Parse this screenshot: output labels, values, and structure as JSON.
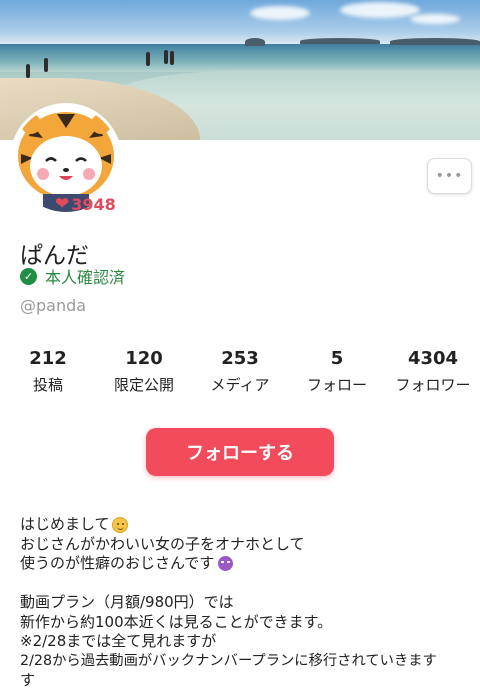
{
  "profile": {
    "likes_count": "3948",
    "display_name": "ぱんだ",
    "verified_label": "本人確認済",
    "handle": "@panda",
    "more_label": "•••"
  },
  "stats": [
    {
      "value": "212",
      "label": "投稿"
    },
    {
      "value": "120",
      "label": "限定公開"
    },
    {
      "value": "253",
      "label": "メディア"
    },
    {
      "value": "5",
      "label": "フォロー"
    },
    {
      "value": "4304",
      "label": "フォロワー"
    }
  ],
  "follow_button_label": "フォローする",
  "bio": {
    "line1": "はじめまして",
    "line2": "おじさんがかわいい女の子をオナホとして",
    "line3": "使うのが性癖のおじさんです",
    "line4": "動画プラン（月額/980円）では",
    "line5": "新作から約100本近くは見ることができます。",
    "line6": "※2/28までは全て見れますが",
    "line7": "2/28から過去動画がバックナンバープランに移行されていきます",
    "line8": "す"
  },
  "colors": {
    "accent": "#f24b5b",
    "verified": "#2a8a43",
    "likes": "#e24a5c"
  },
  "icons": [
    "heart-icon",
    "check-icon",
    "more-icon",
    "smile-emoji-icon",
    "devil-emoji-icon"
  ]
}
